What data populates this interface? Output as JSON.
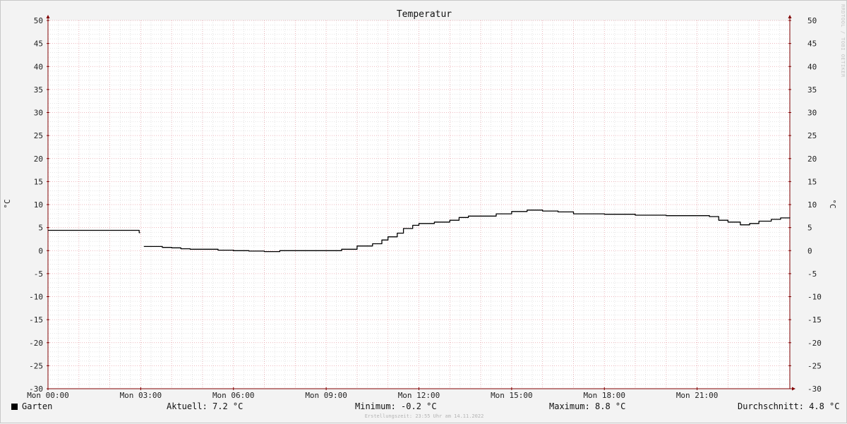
{
  "chart_data": {
    "type": "line",
    "title": "Temperatur",
    "ylabel": "°C",
    "ylim": [
      -30,
      50
    ],
    "yticks": [
      50,
      45,
      40,
      35,
      30,
      25,
      20,
      15,
      10,
      5,
      0,
      -5,
      -10,
      -15,
      -20,
      -25,
      -30
    ],
    "xlim": [
      0,
      24
    ],
    "xticks": [
      {
        "hour": 0,
        "label": "Mon 00:00"
      },
      {
        "hour": 3,
        "label": "Mon 03:00"
      },
      {
        "hour": 6,
        "label": "Mon 06:00"
      },
      {
        "hour": 9,
        "label": "Mon 09:00"
      },
      {
        "hour": 12,
        "label": "Mon 12:00"
      },
      {
        "hour": 15,
        "label": "Mon 15:00"
      },
      {
        "hour": 18,
        "label": "Mon 18:00"
      },
      {
        "hour": 21,
        "label": "Mon 21:00"
      }
    ],
    "grid": true,
    "series": [
      {
        "name": "Garten",
        "color": "#000000",
        "segments": [
          [
            [
              0.0,
              4.4
            ],
            [
              2.9,
              4.4
            ],
            [
              2.95,
              3.9
            ],
            [
              2.98,
              3.9
            ]
          ],
          [
            [
              3.1,
              0.9
            ],
            [
              3.4,
              0.9
            ],
            [
              3.7,
              0.7
            ],
            [
              4.0,
              0.6
            ],
            [
              4.3,
              0.4
            ],
            [
              4.6,
              0.3
            ],
            [
              5.0,
              0.3
            ],
            [
              5.5,
              0.1
            ],
            [
              6.0,
              0.0
            ],
            [
              6.5,
              -0.1
            ],
            [
              7.0,
              -0.2
            ],
            [
              7.5,
              0.0
            ],
            [
              8.0,
              0.0
            ],
            [
              8.5,
              0.0
            ],
            [
              9.0,
              0.0
            ],
            [
              9.5,
              0.3
            ],
            [
              10.0,
              1.0
            ],
            [
              10.5,
              1.5
            ],
            [
              10.8,
              2.3
            ],
            [
              11.0,
              3.0
            ],
            [
              11.3,
              3.8
            ],
            [
              11.5,
              4.8
            ],
            [
              11.8,
              5.5
            ],
            [
              12.0,
              5.9
            ],
            [
              12.5,
              6.2
            ],
            [
              13.0,
              6.6
            ],
            [
              13.3,
              7.2
            ],
            [
              13.6,
              7.5
            ],
            [
              14.0,
              7.5
            ],
            [
              14.5,
              8.0
            ],
            [
              15.0,
              8.5
            ],
            [
              15.5,
              8.8
            ],
            [
              16.0,
              8.6
            ],
            [
              16.5,
              8.4
            ],
            [
              17.0,
              8.0
            ],
            [
              18.0,
              7.9
            ],
            [
              19.0,
              7.7
            ],
            [
              20.0,
              7.6
            ],
            [
              21.0,
              7.6
            ],
            [
              21.4,
              7.4
            ],
            [
              21.7,
              6.6
            ],
            [
              22.0,
              6.2
            ],
            [
              22.4,
              5.6
            ],
            [
              22.7,
              5.9
            ],
            [
              23.0,
              6.4
            ],
            [
              23.4,
              6.8
            ],
            [
              23.7,
              7.1
            ],
            [
              24.0,
              7.2
            ]
          ]
        ]
      }
    ]
  },
  "legend": {
    "series_name": "Garten",
    "aktuell": "Aktuell: 7.2 °C",
    "minimum": "Minimum: -0.2 °C",
    "maximum": "Maximum: 8.8 °C",
    "durchschnitt": "Durchschnitt: 4.8 °C"
  },
  "footer": "Erstellungszeit: 23:55 Uhr am 14.11.2022",
  "watermark": "RRDTOOL / TOBI OETIKER",
  "colors": {
    "background": "#f3f3f3",
    "plot_background": "#ffffff",
    "major_grid": "#e8a0a8",
    "minor_grid": "#d4d4d4",
    "axis": "#800000",
    "line": "#000000"
  }
}
